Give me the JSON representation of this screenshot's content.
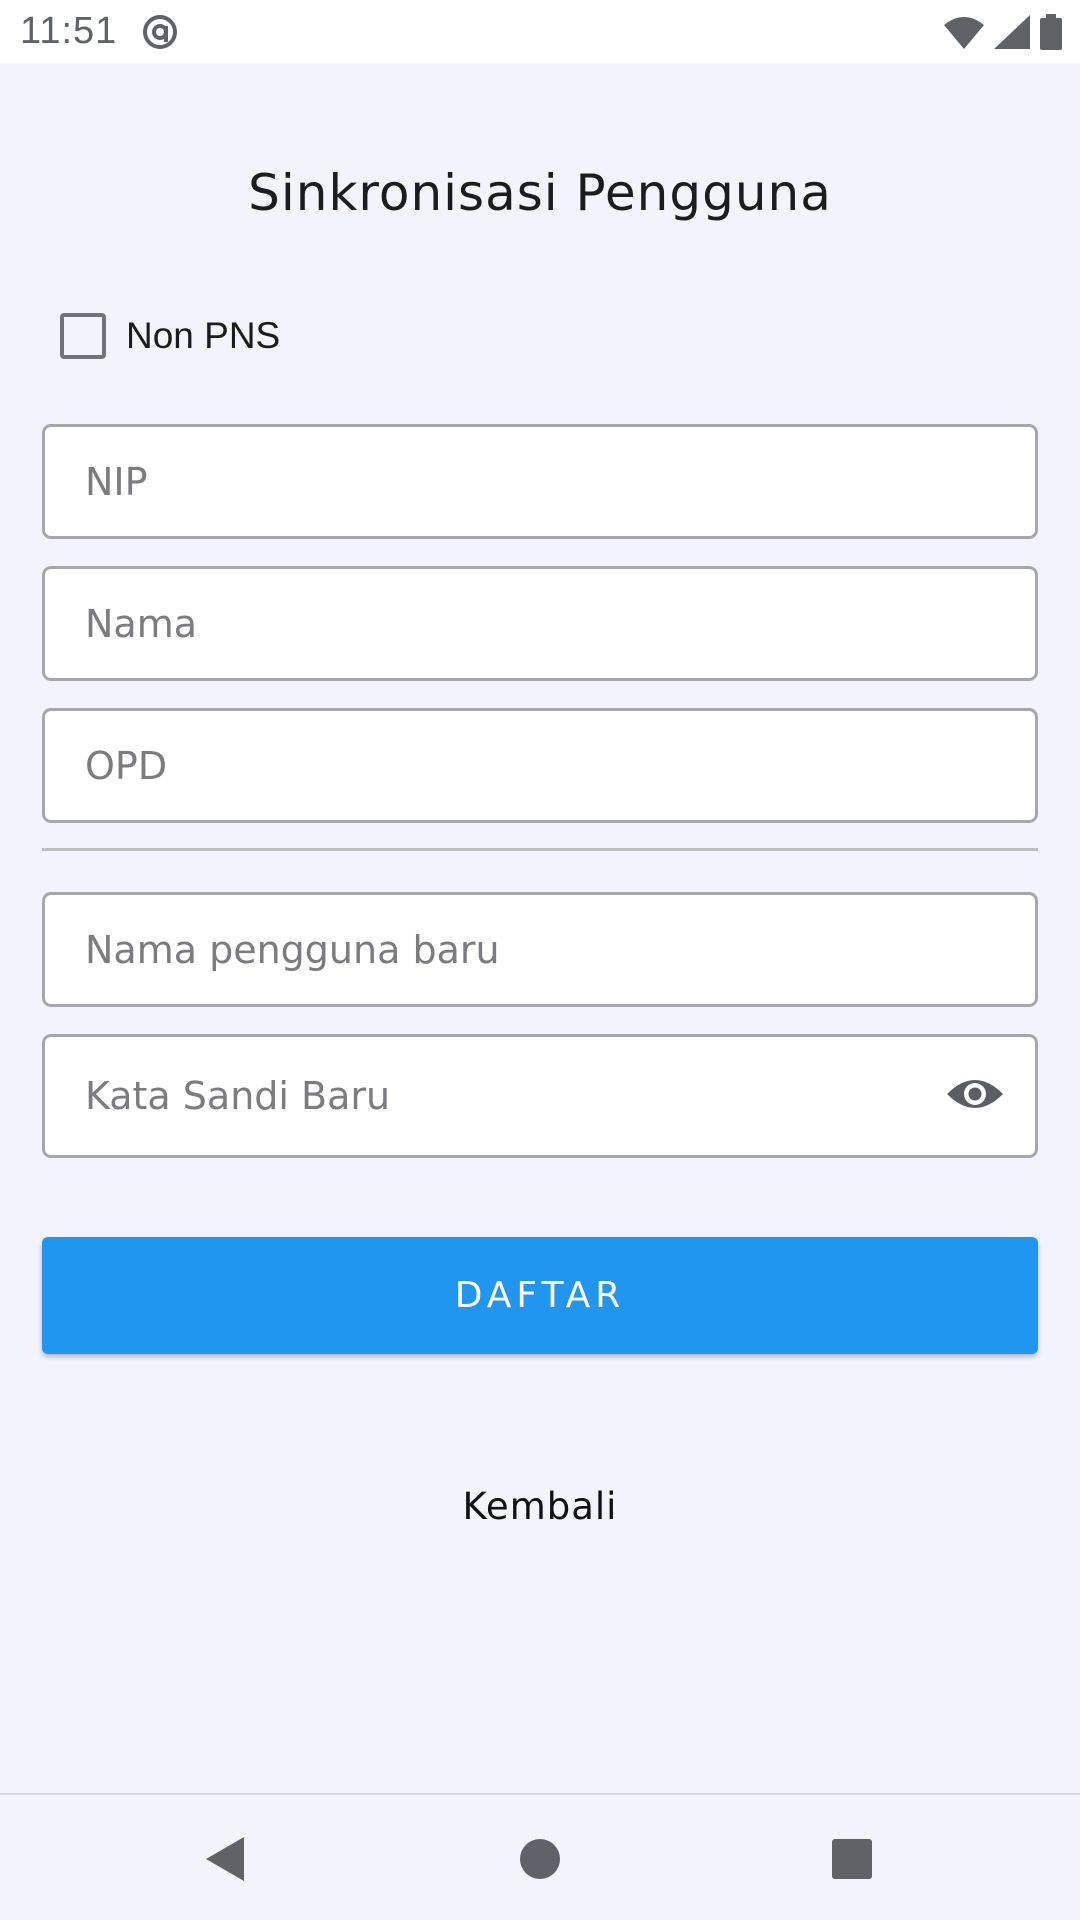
{
  "status_bar": {
    "time": "11:51"
  },
  "page": {
    "title": "Sinkronisasi Pengguna"
  },
  "form": {
    "non_pns_label": "Non PNS",
    "nip_placeholder": "NIP",
    "nama_placeholder": "Nama",
    "opd_placeholder": "OPD",
    "username_placeholder": "Nama pengguna baru",
    "password_placeholder": "Kata Sandi Baru",
    "submit_label": "DAFTAR",
    "back_label": "Kembali"
  },
  "colors": {
    "primary": "#2196f0",
    "background": "#f3f3fd"
  }
}
